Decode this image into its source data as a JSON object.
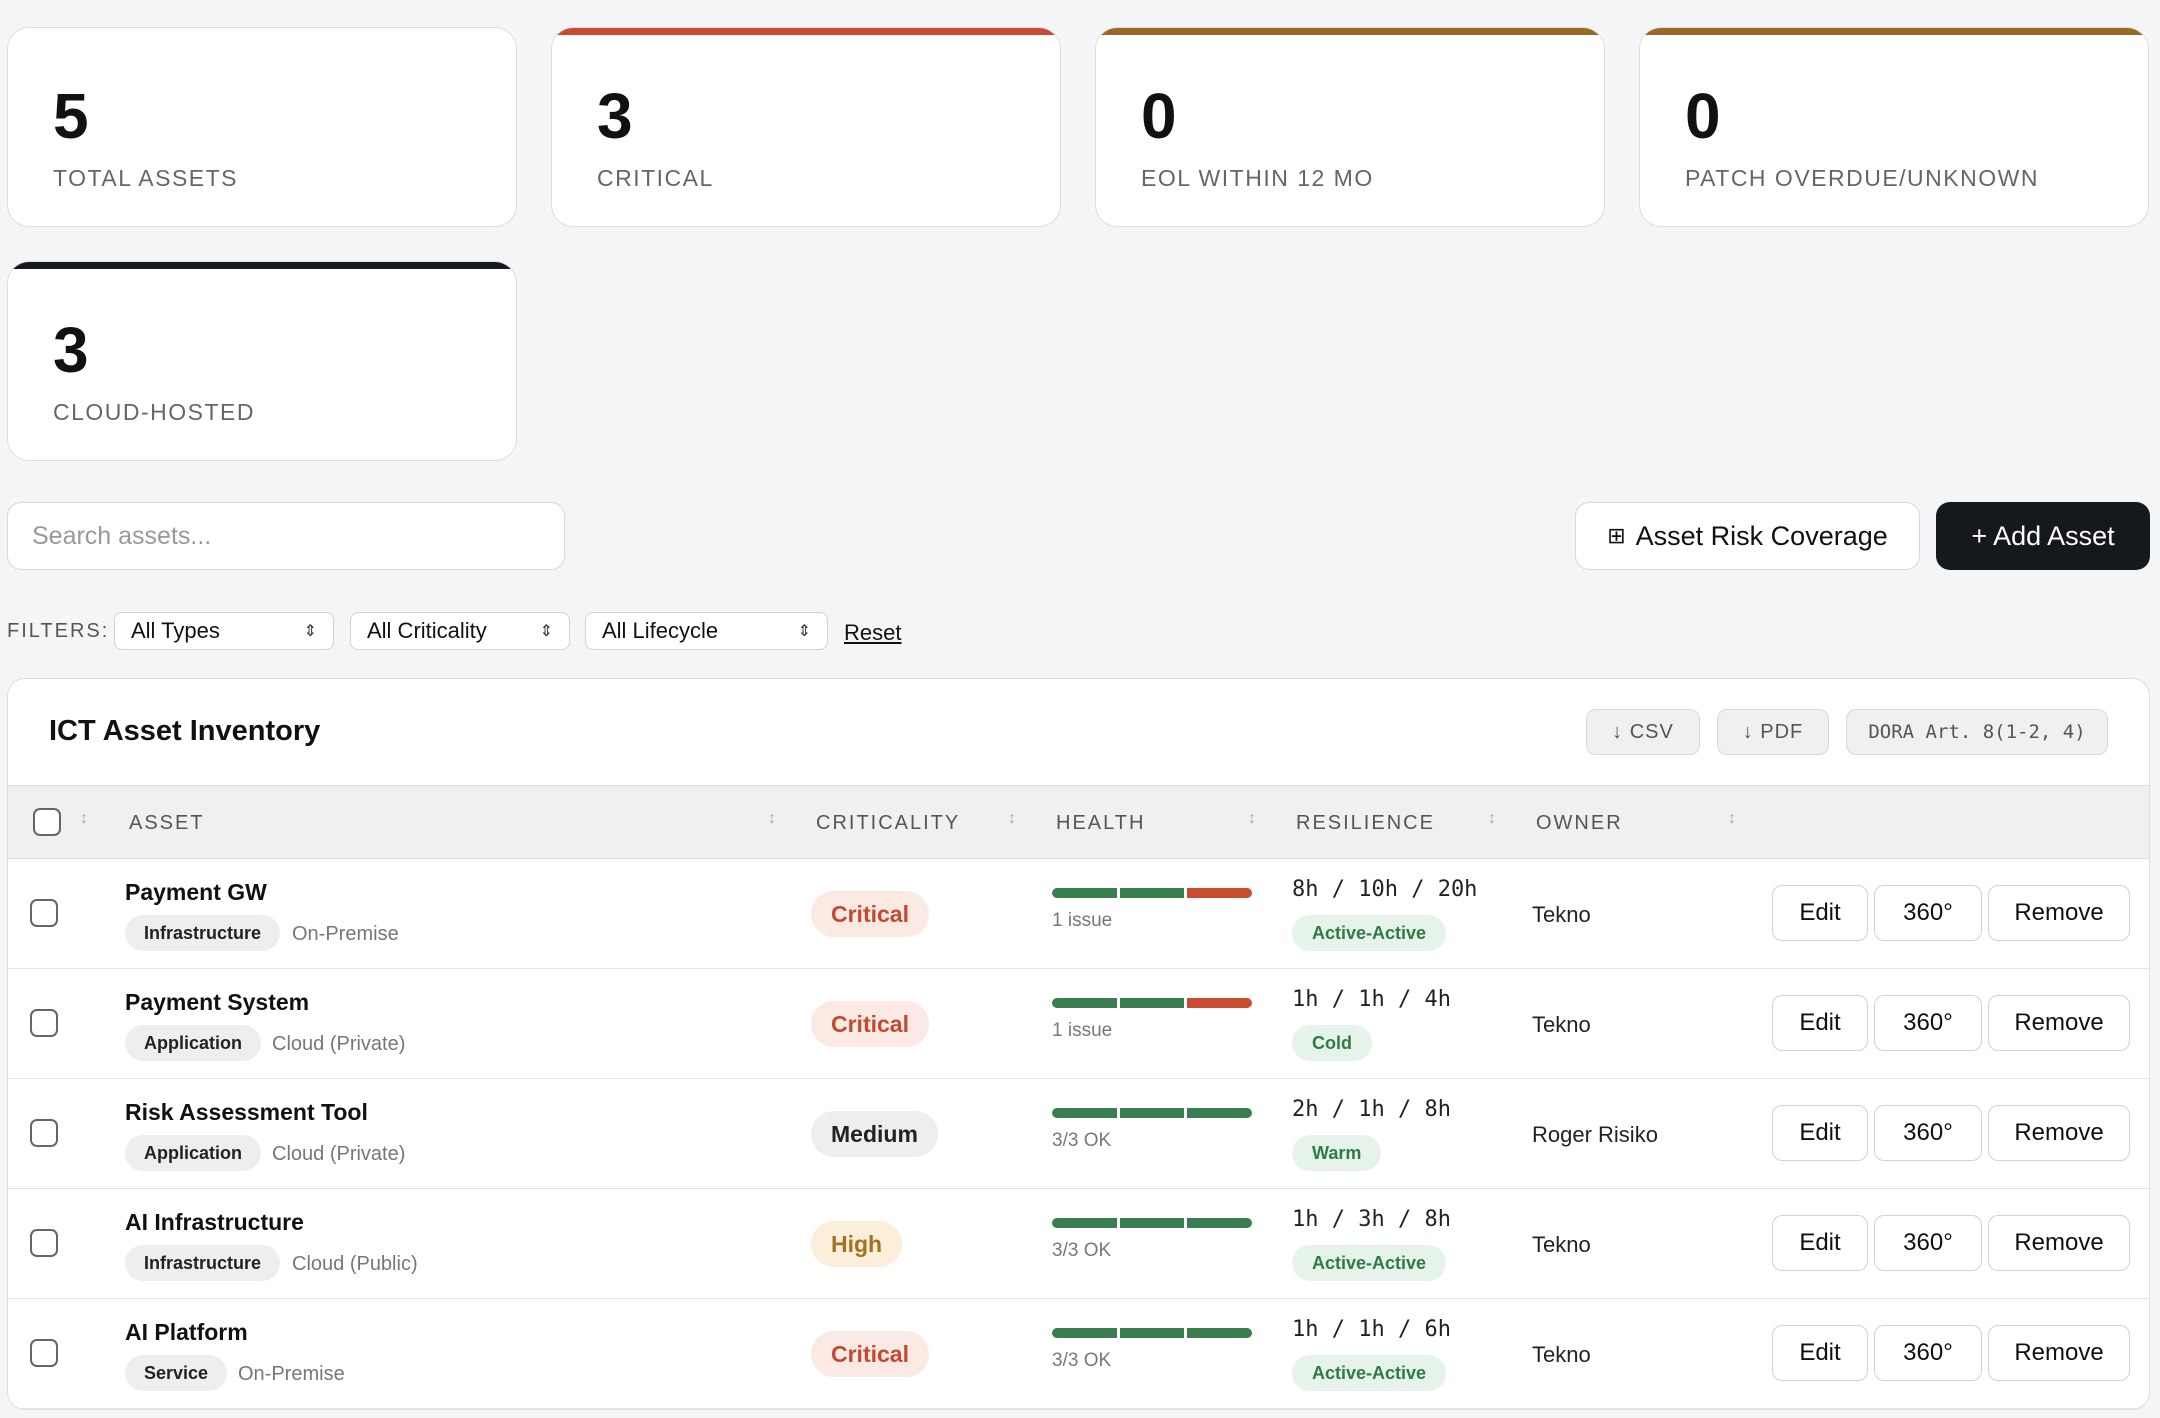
{
  "stats": [
    {
      "value": "5",
      "label": "TOTAL ASSETS",
      "accent": ""
    },
    {
      "value": "3",
      "label": "CRITICAL",
      "accent": "#c94b30"
    },
    {
      "value": "0",
      "label": "EOL WITHIN 12 MO",
      "accent": "#9a6a24"
    },
    {
      "value": "0",
      "label": "PATCH OVERDUE/UNKNOWN",
      "accent": "#9a6a24"
    },
    {
      "value": "3",
      "label": "CLOUD-HOSTED",
      "accent": "#15181c"
    }
  ],
  "search": {
    "placeholder": "Search assets..."
  },
  "toolbar": {
    "coverage_icon": "grid-icon",
    "coverage_glyph": "⊞",
    "coverage_label": "Asset Risk Coverage",
    "add_label": "+ Add Asset"
  },
  "filters": {
    "label": "FILTERS:",
    "type": "All Types",
    "criticality": "All Criticality",
    "lifecycle": "All Lifecycle",
    "reset": "Reset"
  },
  "inventory": {
    "title": "ICT Asset Inventory",
    "csv": "↓ CSV",
    "pdf": "↓ PDF",
    "dora": "DORA Art. 8(1-2, 4)",
    "columns": {
      "asset": "ASSET",
      "criticality": "CRITICALITY",
      "health": "HEALTH",
      "resilience": "RESILIENCE",
      "owner": "OWNER"
    },
    "colors": {
      "ok": "#3a7d4f",
      "issue": "#c94b30"
    },
    "rows": [
      {
        "name": "Payment GW",
        "type": "Infrastructure",
        "hosting": "On-Premise",
        "criticality": "Critical",
        "crit_class": "critical",
        "health_segments": [
          "ok",
          "ok",
          "issue"
        ],
        "health_text": "1 issue",
        "rto": "8h / 10h / 20h",
        "resilience": "Active-Active",
        "owner": "Tekno"
      },
      {
        "name": "Payment System",
        "type": "Application",
        "hosting": "Cloud (Private)",
        "criticality": "Critical",
        "crit_class": "critical",
        "health_segments": [
          "ok",
          "ok",
          "issue"
        ],
        "health_text": "1 issue",
        "rto": "1h / 1h / 4h",
        "resilience": "Cold",
        "owner": "Tekno"
      },
      {
        "name": "Risk Assessment Tool",
        "type": "Application",
        "hosting": "Cloud (Private)",
        "criticality": "Medium",
        "crit_class": "medium",
        "health_segments": [
          "ok",
          "ok",
          "ok"
        ],
        "health_text": "3/3 OK",
        "rto": "2h / 1h / 8h",
        "resilience": "Warm",
        "owner": "Roger Risiko"
      },
      {
        "name": "AI Infrastructure",
        "type": "Infrastructure",
        "hosting": "Cloud (Public)",
        "criticality": "High",
        "crit_class": "high",
        "health_segments": [
          "ok",
          "ok",
          "ok"
        ],
        "health_text": "3/3 OK",
        "rto": "1h / 3h / 8h",
        "resilience": "Active-Active",
        "owner": "Tekno"
      },
      {
        "name": "AI Platform",
        "type": "Service",
        "hosting": "On-Premise",
        "criticality": "Critical",
        "crit_class": "critical",
        "health_segments": [
          "ok",
          "ok",
          "ok"
        ],
        "health_text": "3/3 OK",
        "rto": "1h / 1h / 6h",
        "resilience": "Active-Active",
        "owner": "Tekno"
      }
    ],
    "actions": {
      "edit": "Edit",
      "view": "360°",
      "remove": "Remove"
    }
  }
}
